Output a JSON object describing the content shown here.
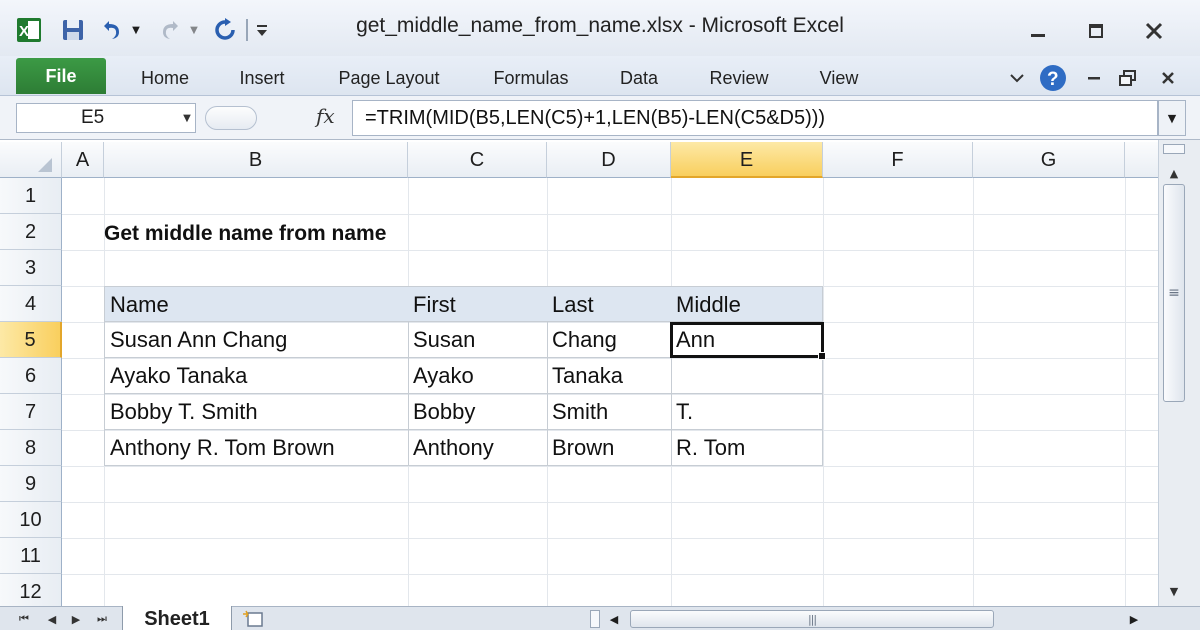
{
  "window": {
    "title": "get_middle_name_from_name.xlsx  -  Microsoft Excel",
    "icons": [
      "excel-app-icon",
      "save-icon",
      "undo-icon",
      "redo-icon",
      "repeat-icon",
      "customize-qat-icon"
    ]
  },
  "ribbon": {
    "tabs": [
      "File",
      "Home",
      "Insert",
      "Page Layout",
      "Formulas",
      "Data",
      "Review",
      "View"
    ]
  },
  "formula_bar": {
    "name_box": "E5",
    "fx": "fx",
    "formula": "=TRIM(MID(B5,LEN(C5)+1,LEN(B5)-LEN(C5&D5)))"
  },
  "grid": {
    "columns": [
      "A",
      "B",
      "C",
      "D",
      "E",
      "F",
      "G"
    ],
    "selected_column": "E",
    "rows": [
      "1",
      "2",
      "3",
      "4",
      "5",
      "6",
      "7",
      "8",
      "9",
      "10",
      "11",
      "12"
    ],
    "selected_row": "5",
    "heading": "Get middle name from name",
    "table": {
      "headers": [
        "Name",
        "First",
        "Last",
        "Middle"
      ],
      "rows": [
        [
          "Susan Ann Chang",
          "Susan",
          "Chang",
          "Ann"
        ],
        [
          "Ayako Tanaka",
          "Ayako",
          "Tanaka",
          ""
        ],
        [
          "Bobby T. Smith",
          "Bobby",
          "Smith",
          "T."
        ],
        [
          "Anthony R. Tom Brown",
          "Anthony",
          "Brown",
          "R. Tom"
        ]
      ]
    }
  },
  "sheets": {
    "tabs": [
      "Sheet1"
    ],
    "active": "Sheet1"
  },
  "colors": {
    "file_tab": "#2d7d35",
    "header_fill": "#dde6f1",
    "selected_header": "#f9cf5e"
  }
}
